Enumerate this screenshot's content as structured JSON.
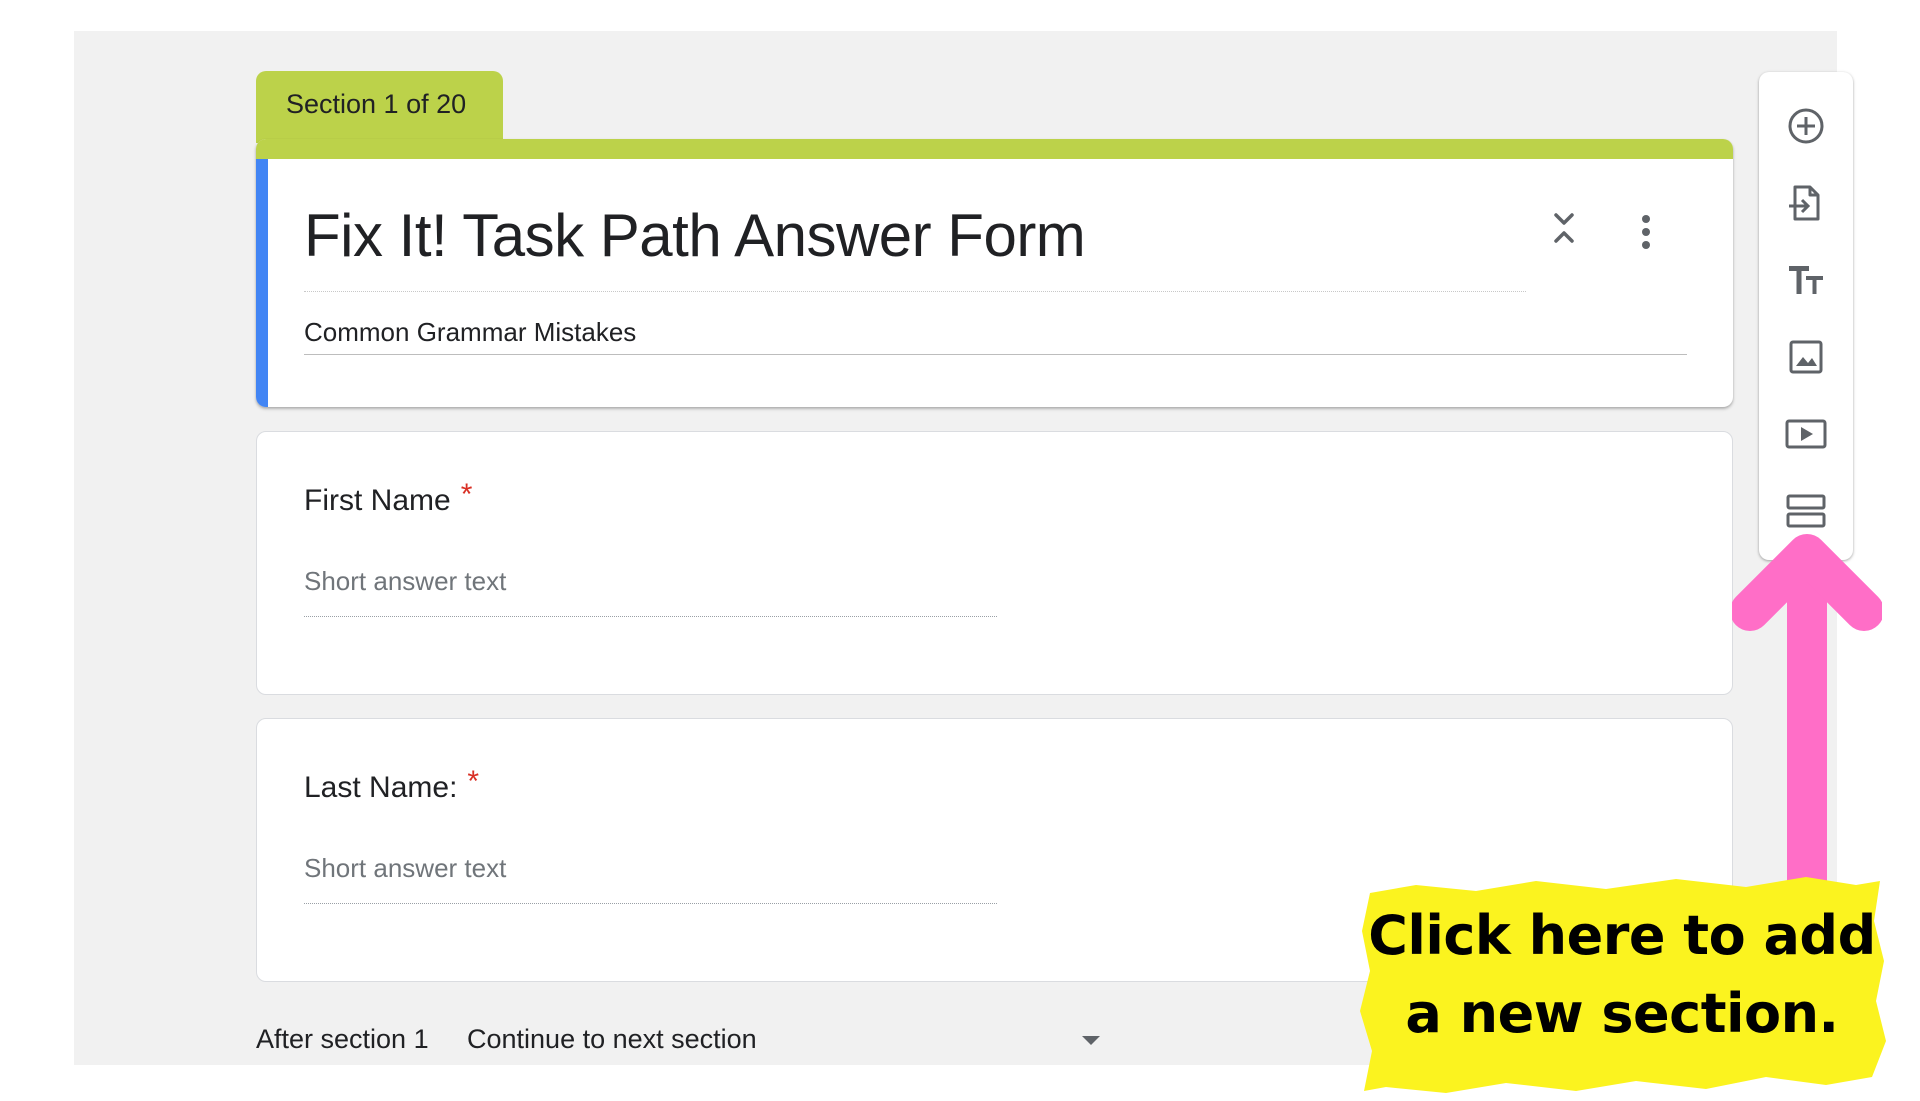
{
  "form": {
    "section_tab": "Section 1 of 20",
    "title": "Fix It! Task Path Answer Form",
    "description": "Common Grammar Mistakes"
  },
  "questions": [
    {
      "title": "First Name",
      "required_mark": "*",
      "answer_placeholder": "Short answer text"
    },
    {
      "title": "Last Name:",
      "required_mark": "*",
      "answer_placeholder": "Short answer text"
    }
  ],
  "after_section": {
    "label": "After section 1",
    "selected": "Continue to next section"
  },
  "toolbar": {
    "buttons": [
      {
        "icon": "add-circle-icon"
      },
      {
        "icon": "import-questions-icon"
      },
      {
        "icon": "title-text-icon"
      },
      {
        "icon": "image-icon"
      },
      {
        "icon": "video-icon"
      },
      {
        "icon": "section-icon"
      }
    ]
  },
  "annotation": {
    "callout_line1": "Click here to add",
    "callout_line2": "a new section.",
    "arrow_color": "#ff6ec7",
    "highlight_color": "#fbf31f"
  },
  "colors": {
    "theme": "#bcd24a",
    "accent": "#4285f4",
    "required": "#d93025",
    "background": "#f1f1f1"
  }
}
